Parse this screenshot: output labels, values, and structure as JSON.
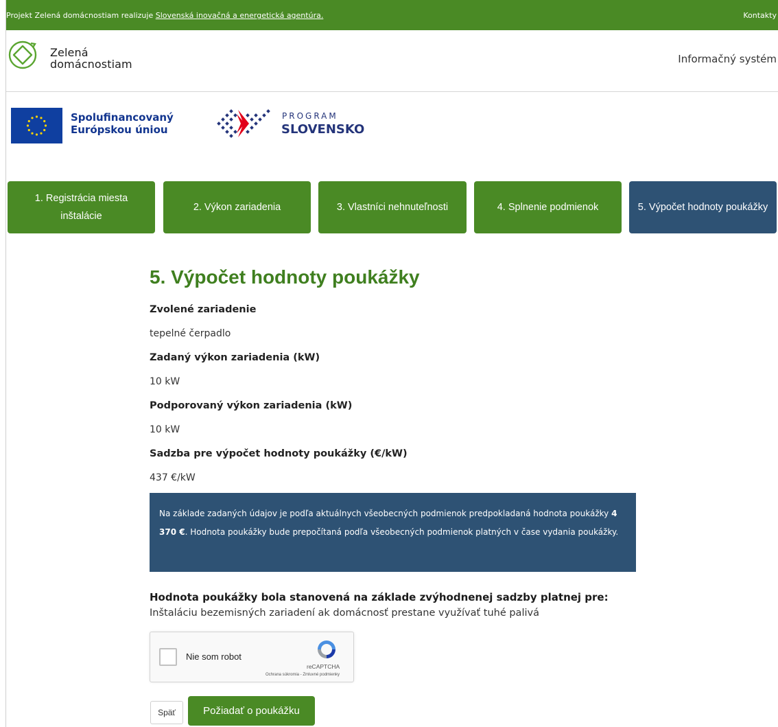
{
  "topbar": {
    "lead_text": "Projekt Zelená domácnostiam realizuje ",
    "lead_link": "Slovenská inovačná a energetická agentúra.",
    "contacts": "Kontakty"
  },
  "header": {
    "brand_line1": "Zelená",
    "brand_line2": "domácnostiam",
    "system": "Informačný systém"
  },
  "cofinance": {
    "eu_line1": "Spolufinancovaný",
    "eu_line2": "Európskou úniou",
    "program_word1": "PROGRAM",
    "program_word2": "SLOVENSKO"
  },
  "steps": [
    {
      "label": "1. Registrácia miesta inštalácie"
    },
    {
      "label": "2. Výkon zariadenia"
    },
    {
      "label": "3. Vlastníci nehnuteľnosti"
    },
    {
      "label": "4. Splnenie podmienok"
    },
    {
      "label": "5. Výpočet hodnoty poukážky"
    }
  ],
  "main": {
    "title": "5. Výpočet hodnoty poukážky",
    "fields": [
      {
        "label": "Zvolené zariadenie",
        "value": "tepelné čerpadlo"
      },
      {
        "label": "Zadaný výkon zariadenia (kW)",
        "value": "10 kW"
      },
      {
        "label": "Podporovaný výkon zariadenia (kW)",
        "value": "10 kW"
      },
      {
        "label": "Sadzba pre výpočet hodnoty poukážky (€/kW)",
        "value": "437 €/kW"
      }
    ],
    "info": {
      "part1": "Na základe zadaných údajov je podľa aktuálnych všeobecných podmienok predpokladaná hodnota poukážky ",
      "amount": "4 370 €",
      "part2": ". Hodnota poukážky bude prepočítaná podľa všeobecných podmienok platných v čase vydania poukážky."
    },
    "basis_title": "Hodnota poukážky bola stanovená na základe zvýhodnenej sadzby platnej pre:",
    "basis_text": "Inštaláciu bezemisných zariadení ak domácnosť prestane využívať tuhé palivá"
  },
  "captcha": {
    "label": "Nie som robot",
    "brand": "reCAPTCHA",
    "terms": "Ochrana súkromia - Zmluvné podmienky"
  },
  "buttons": {
    "back": "Späť",
    "submit": "Požiadať o poukážku"
  },
  "colors": {
    "green": "#4a8a25",
    "navy": "#2e5274",
    "title_green": "#3f7f1f"
  }
}
